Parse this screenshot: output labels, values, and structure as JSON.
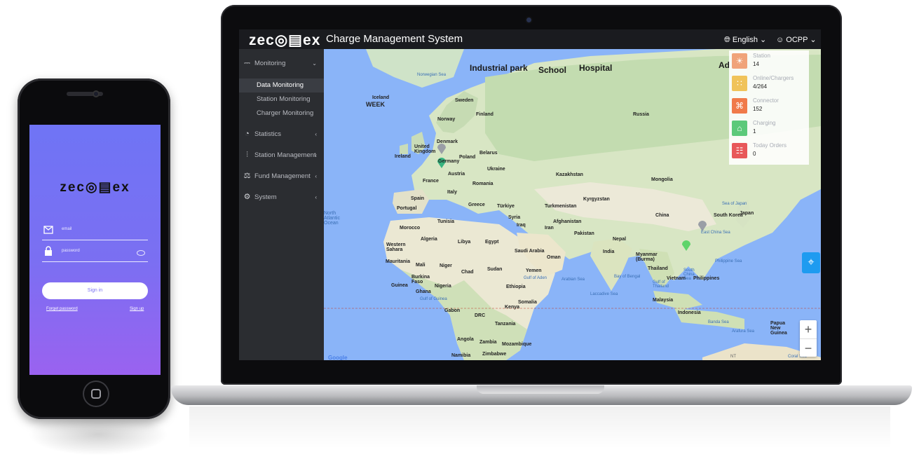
{
  "phone": {
    "logo": "zec◎▤ex",
    "email_placeholder": "email",
    "password_placeholder": "password",
    "signin_label": "Sign in",
    "forgot_label": "Forget password",
    "signup_label": "Sign up"
  },
  "header": {
    "brand": "zec◎▤ex",
    "title": "Charge Management System",
    "language": "English",
    "user": "OCPP"
  },
  "sidebar": {
    "items": [
      {
        "label": "Monitoring",
        "icon": "line-chart-icon"
      },
      {
        "label": "Statistics",
        "icon": "pie-chart-icon"
      },
      {
        "label": "Station Management",
        "icon": "sliders-icon"
      },
      {
        "label": "Fund Management",
        "icon": "money-bag-icon"
      },
      {
        "label": "System",
        "icon": "gear-icon"
      }
    ],
    "subitems": [
      {
        "label": "Data Monitoring",
        "active": true
      },
      {
        "label": "Station Monitoring",
        "active": false
      },
      {
        "label": "Charger Monitoring",
        "active": false
      }
    ]
  },
  "stats": [
    {
      "label": "Station",
      "value": "14",
      "color": "#f0a37a",
      "icon": "station-icon"
    },
    {
      "label": "Online/Chargers",
      "value": "4/264",
      "color": "#f0c35a",
      "icon": "charger-icon"
    },
    {
      "label": "Connector",
      "value": "152",
      "color": "#f07a4a",
      "icon": "connector-icon"
    },
    {
      "label": "Charging",
      "value": "1",
      "color": "#5cc97a",
      "icon": "house-icon"
    },
    {
      "label": "Today Orders",
      "value": "0",
      "color": "#e8585a",
      "icon": "orders-icon"
    }
  ],
  "map": {
    "headlines": [
      "Industrial park",
      "School",
      "Hospital",
      "Ad"
    ],
    "week_label": "WEEK",
    "countries": [
      "Iceland",
      "Norwegian Sea",
      "Sweden",
      "Finland",
      "Norway",
      "Russia",
      "Denmark",
      "United Kingdom",
      "Ireland",
      "Poland",
      "Belarus",
      "Germany",
      "Ukraine",
      "Austria",
      "France",
      "Romania",
      "Kazakhstan",
      "Mongolia",
      "Italy",
      "Spain",
      "Greece",
      "Türkiye",
      "Turkmenistan",
      "Kyrgyzstan",
      "Portugal",
      "Syria",
      "Afghanistan",
      "China",
      "South Korea",
      "Japan",
      "Sea of Japan",
      "North Atlantic Ocean",
      "Tunisia",
      "Iraq",
      "Iran",
      "Pakistan",
      "Morocco",
      "Algeria",
      "Libya",
      "Egypt",
      "Nepal",
      "East China Sea",
      "Western Sahara",
      "Saudi Arabia",
      "India",
      "Myanmar (Burma)",
      "Mauritania",
      "Mali",
      "Niger",
      "Oman",
      "Thailand",
      "Philippine Sea",
      "Chad",
      "Sudan",
      "Yemen",
      "Bay of Bengal",
      "Burkina Faso",
      "Gulf of Aden",
      "Arabian Sea",
      "Vietnam",
      "Philippines",
      "Guinea",
      "Nigeria",
      "Ethiopia",
      "South China Sea",
      "Gulf of Thailand",
      "Ghana",
      "Laccadive Sea",
      "Gulf of Guinea",
      "Somalia",
      "Malaysia",
      "Gabon",
      "Kenya",
      "DRC",
      "Indonesia",
      "Tanzania",
      "Banda Sea",
      "Papua New Guinea",
      "Arafura Sea",
      "Angola",
      "Zambia",
      "Mozambique",
      "Namibia",
      "Zimbabwe",
      "Coral Sea",
      "Google",
      "NT"
    ],
    "zoom_in": "+",
    "zoom_out": "−"
  }
}
